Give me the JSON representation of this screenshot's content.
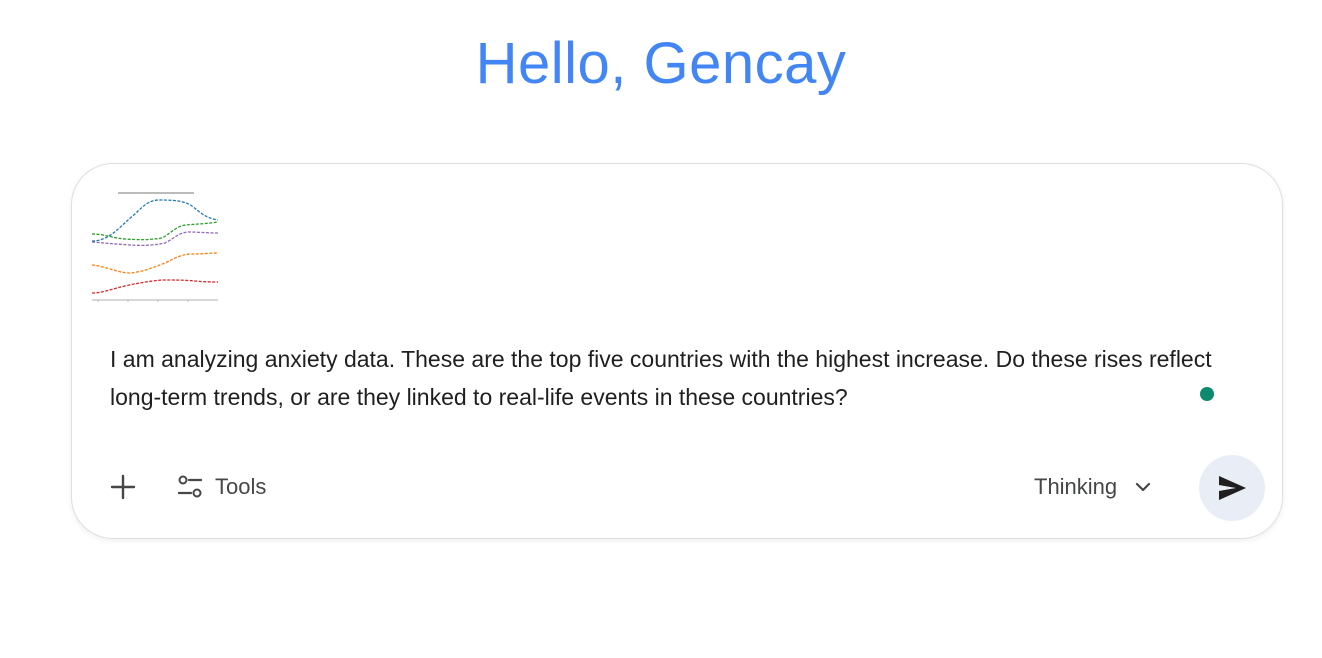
{
  "header": {
    "greeting": "Hello, Gencay"
  },
  "composer": {
    "attachment": {
      "type": "image-thumbnail",
      "series_colors": [
        "#1f77b4",
        "#2ca02c",
        "#9467bd",
        "#ff7f0e",
        "#d62728"
      ]
    },
    "prompt_text": "I am analyzing anxiety data. These are the top five countries with the highest increase. Do these rises reflect long-term trends, or are they linked to real-life events in these countries?",
    "status_dot_color": "#0b8a6f",
    "toolbar": {
      "add_icon": "plus-icon",
      "tools_icon": "tune-icon",
      "tools_label": "Tools",
      "mode_label": "Thinking",
      "mode_icon": "chevron-down-icon",
      "send_icon": "send-icon"
    }
  },
  "colors": {
    "accent": "#4285f4",
    "text": "#1f1f1f",
    "muted_text": "#444746",
    "send_bg": "#e9eef6",
    "border": "#dcdfe3"
  }
}
